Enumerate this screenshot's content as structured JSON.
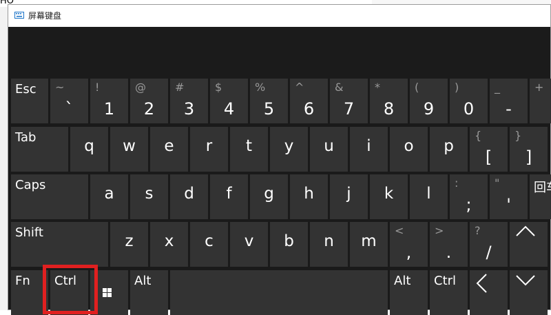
{
  "background_text": "HO",
  "window": {
    "title": "屏幕键盘"
  },
  "rows": [
    [
      {
        "n": "key-esc",
        "l": "Esc"
      },
      {
        "n": "key-backtick",
        "s": "~",
        "b": "`"
      },
      {
        "n": "key-1",
        "s": "!",
        "b": "1"
      },
      {
        "n": "key-2",
        "s": "@",
        "b": "2"
      },
      {
        "n": "key-3",
        "s": "#",
        "b": "3"
      },
      {
        "n": "key-4",
        "s": "$",
        "b": "4"
      },
      {
        "n": "key-5",
        "s": "%",
        "b": "5"
      },
      {
        "n": "key-6",
        "s": "^",
        "b": "6"
      },
      {
        "n": "key-7",
        "s": "&",
        "b": "7"
      },
      {
        "n": "key-8",
        "s": "*",
        "b": "8"
      },
      {
        "n": "key-9",
        "s": "(",
        "b": "9"
      },
      {
        "n": "key-0",
        "s": ")",
        "b": "0"
      },
      {
        "n": "key-minus",
        "s": "_",
        "b": "-"
      },
      {
        "n": "key-equals",
        "s": "+",
        "b": ""
      }
    ],
    [
      {
        "n": "key-tab",
        "l": "Tab"
      },
      {
        "n": "key-q",
        "c": "q"
      },
      {
        "n": "key-w",
        "c": "w"
      },
      {
        "n": "key-e",
        "c": "e"
      },
      {
        "n": "key-r",
        "c": "r"
      },
      {
        "n": "key-t",
        "c": "t"
      },
      {
        "n": "key-y",
        "c": "y"
      },
      {
        "n": "key-u",
        "c": "u"
      },
      {
        "n": "key-i",
        "c": "i"
      },
      {
        "n": "key-o",
        "c": "o"
      },
      {
        "n": "key-p",
        "c": "p"
      },
      {
        "n": "key-open-bracket",
        "s": "{",
        "b": "["
      },
      {
        "n": "key-close-bracket",
        "s": "}",
        "b": "]"
      }
    ],
    [
      {
        "n": "key-caps",
        "l": "Caps"
      },
      {
        "n": "key-a",
        "c": "a"
      },
      {
        "n": "key-s",
        "c": "s"
      },
      {
        "n": "key-d",
        "c": "d"
      },
      {
        "n": "key-f",
        "c": "f"
      },
      {
        "n": "key-g",
        "c": "g"
      },
      {
        "n": "key-h",
        "c": "h"
      },
      {
        "n": "key-j",
        "c": "j"
      },
      {
        "n": "key-k",
        "c": "k"
      },
      {
        "n": "key-l",
        "c": "l"
      },
      {
        "n": "key-semicolon",
        "s": ":",
        "b": ";"
      },
      {
        "n": "key-quote",
        "s": "\"",
        "b": "'"
      },
      {
        "n": "key-enter",
        "l": "回车"
      }
    ],
    [
      {
        "n": "key-shift",
        "l": "Shift"
      },
      {
        "n": "key-z",
        "c": "z"
      },
      {
        "n": "key-x",
        "c": "x"
      },
      {
        "n": "key-c",
        "c": "c"
      },
      {
        "n": "key-v",
        "c": "v"
      },
      {
        "n": "key-b",
        "c": "b"
      },
      {
        "n": "key-n",
        "c": "n"
      },
      {
        "n": "key-m",
        "c": "m"
      },
      {
        "n": "key-comma",
        "s": "<",
        "b": ","
      },
      {
        "n": "key-period",
        "s": ">",
        "b": "."
      },
      {
        "n": "key-slash",
        "s": "?",
        "b": "/"
      },
      {
        "n": "key-arrow-up",
        "i": "up"
      }
    ],
    [
      {
        "n": "key-fn",
        "l": "Fn"
      },
      {
        "n": "key-ctrl-left",
        "l": "Ctrl"
      },
      {
        "n": "key-windows",
        "i": "win"
      },
      {
        "n": "key-alt-left",
        "l": "Alt"
      },
      {
        "n": "key-space",
        "l": ""
      },
      {
        "n": "key-alt-right",
        "l": "Alt"
      },
      {
        "n": "key-ctrl-right",
        "l": "Ctrl"
      },
      {
        "n": "key-arrow-left",
        "i": "left"
      },
      {
        "n": "key-arrow-down",
        "i": "down"
      }
    ]
  ],
  "highlight": {
    "color": "#e02020",
    "target": "Ctrl"
  }
}
